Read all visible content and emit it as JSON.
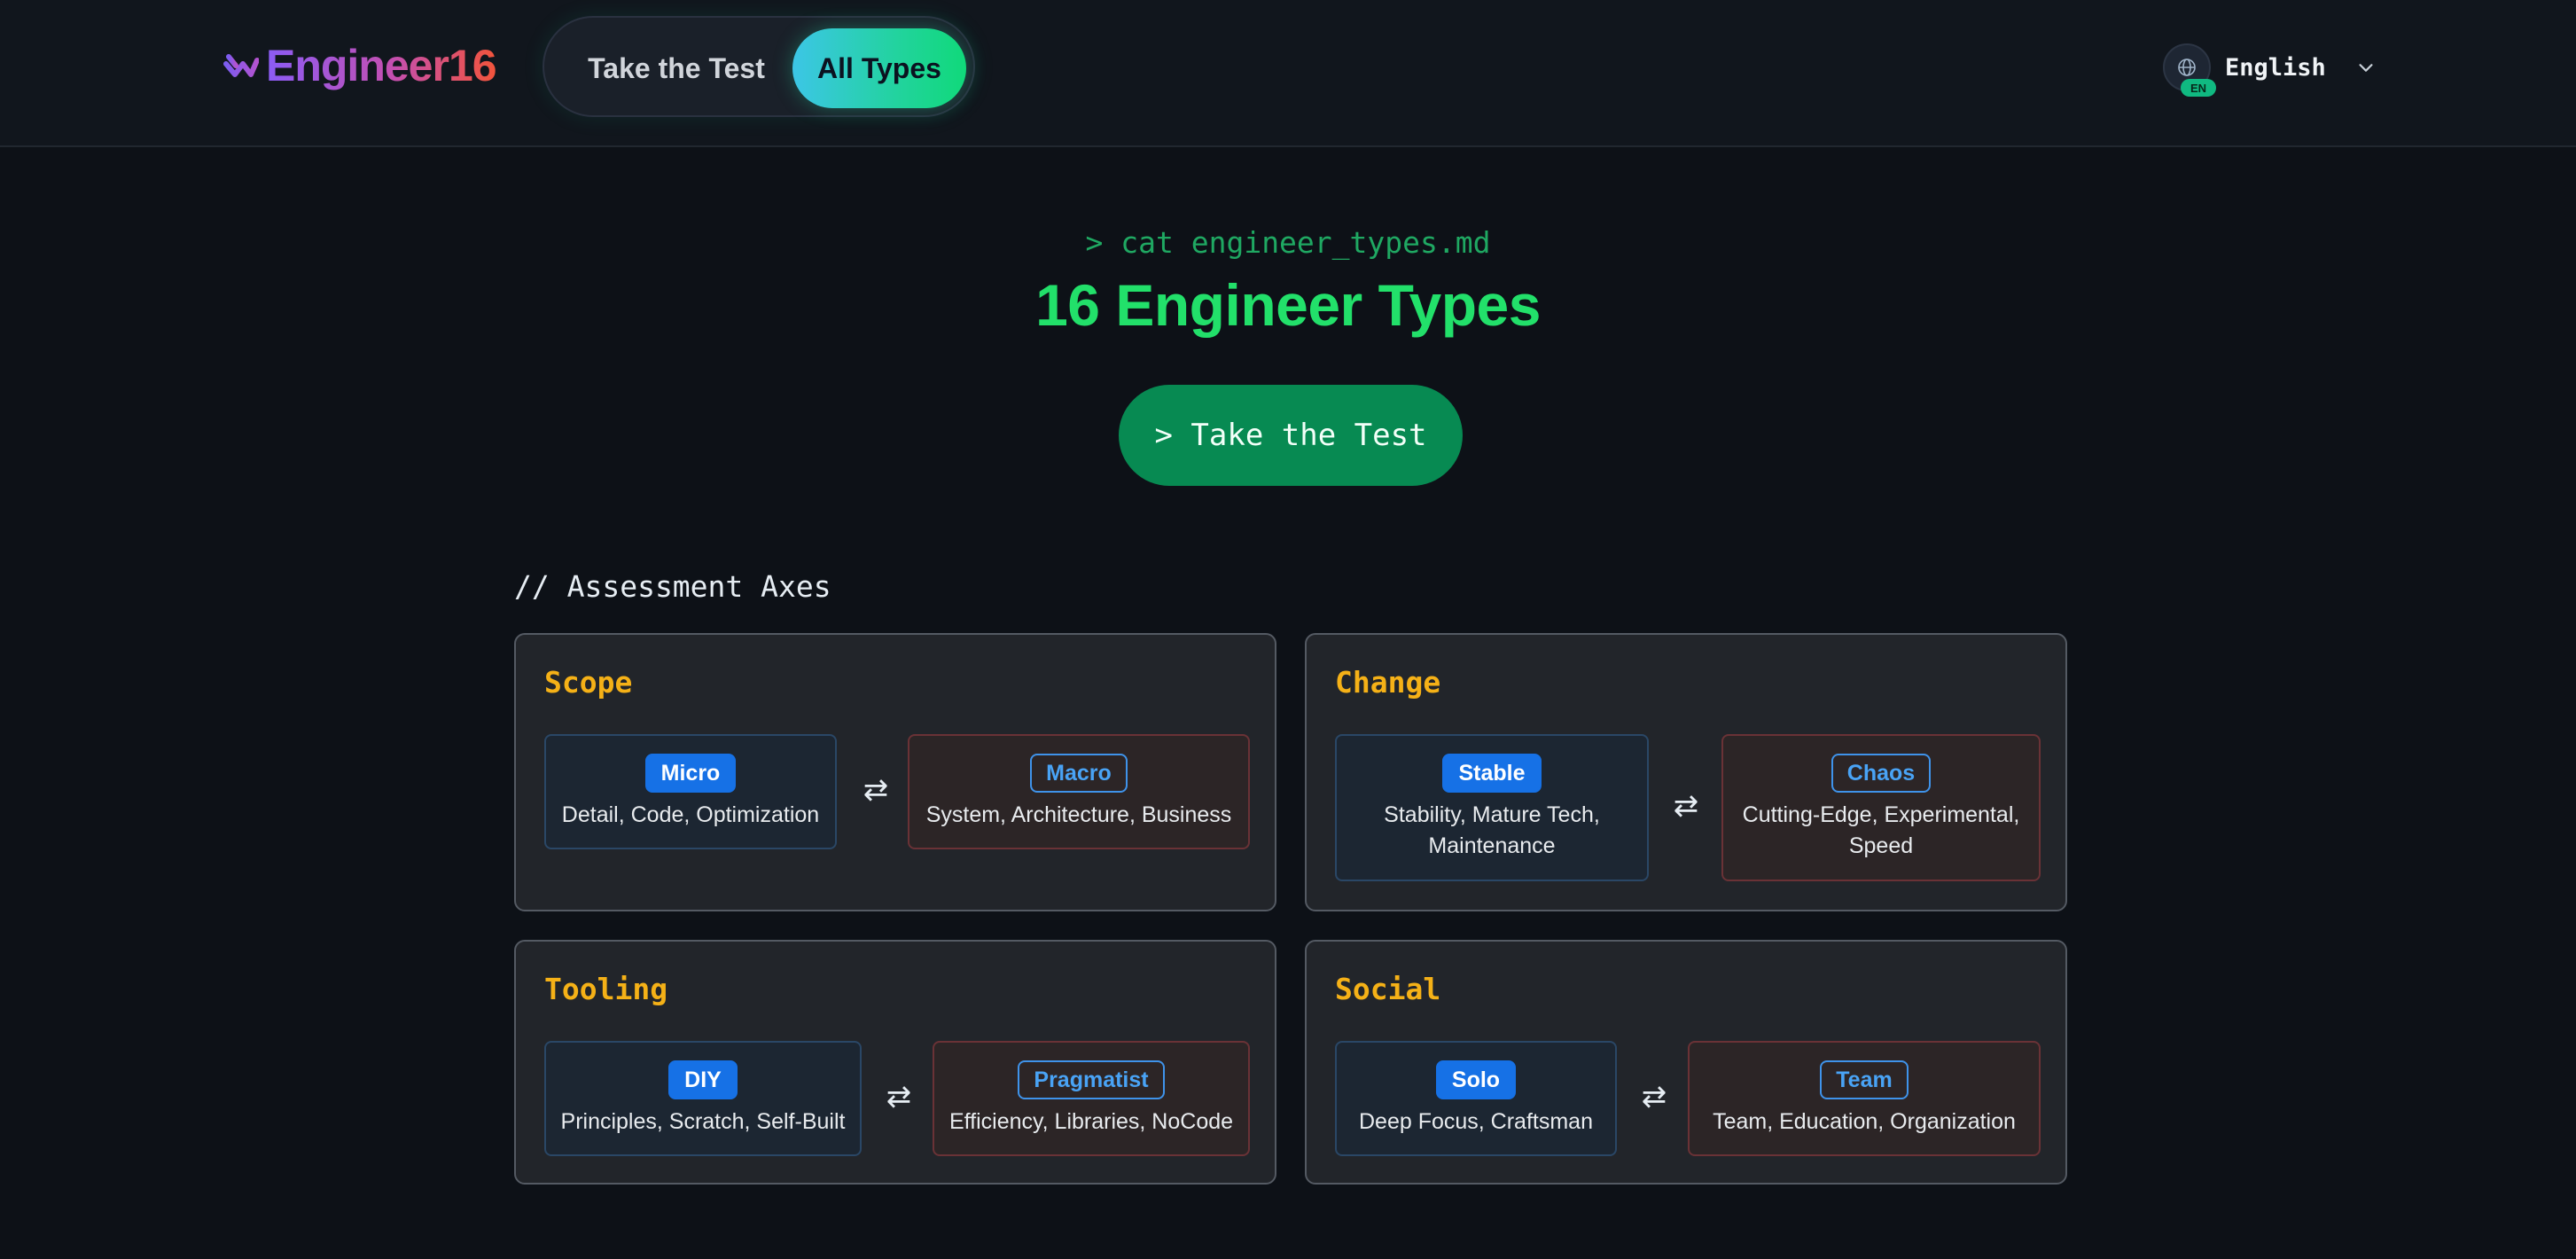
{
  "header": {
    "logo_text": "Engineer16",
    "nav": [
      {
        "label": "Take the Test",
        "active": false
      },
      {
        "label": "All Types",
        "active": true
      }
    ],
    "language": {
      "label": "English",
      "badge": "EN",
      "icon": "globe-icon"
    }
  },
  "hero": {
    "command": "> cat engineer_types.md",
    "title": "16 Engineer Types",
    "cta_label": "> Take the Test"
  },
  "axes_section": {
    "title": "// Assessment Axes",
    "axes": [
      {
        "name": "Scope",
        "left": {
          "tag": "Micro",
          "desc": "Detail, Code, Optimization"
        },
        "right": {
          "tag": "Macro",
          "desc": "System, Architecture, Business"
        }
      },
      {
        "name": "Change",
        "left": {
          "tag": "Stable",
          "desc": "Stability, Mature Tech, Maintenance"
        },
        "right": {
          "tag": "Chaos",
          "desc": "Cutting-Edge, Experimental, Speed"
        }
      },
      {
        "name": "Tooling",
        "left": {
          "tag": "DIY",
          "desc": "Principles, Scratch, Self-Built"
        },
        "right": {
          "tag": "Pragmatist",
          "desc": "Efficiency, Libraries, NoCode"
        }
      },
      {
        "name": "Social",
        "left": {
          "tag": "Solo",
          "desc": "Deep Focus, Craftsman"
        },
        "right": {
          "tag": "Team",
          "desc": "Team, Education, Organization"
        }
      }
    ],
    "swap_symbol": "⇄"
  },
  "colors": {
    "background": "#0d1117",
    "accent_green": "#22e06a",
    "cta_green": "#078a52",
    "axis_title": "#f5b117",
    "tag_blue": "#1671e6"
  }
}
